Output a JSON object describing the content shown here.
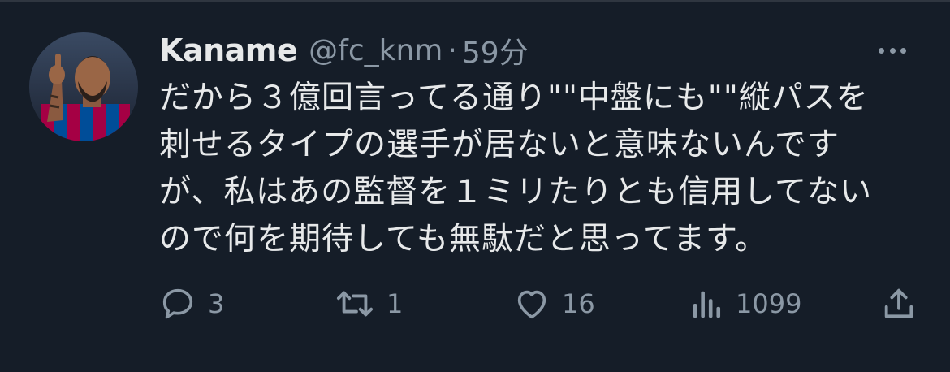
{
  "tweet": {
    "author": {
      "display_name": "Kaname",
      "handle": "@fc_knm",
      "avatar_icon": "user-avatar-photo"
    },
    "separator": "·",
    "time": "59分",
    "text": "だから３億回言ってる通り\"\"中盤にも\"\"縦パスを\n刺せるタイプの選手が居ないと意味ないんです\nが、私はあの監督を１ミリたりとも信用してない\nので何を期待しても無駄だと思ってます。",
    "more_icon": "more-options-icon"
  },
  "actions": {
    "reply": {
      "icon": "reply-icon",
      "count": "3"
    },
    "retweet": {
      "icon": "retweet-icon",
      "count": "1"
    },
    "like": {
      "icon": "heart-icon",
      "count": "16"
    },
    "views": {
      "icon": "views-icon",
      "count": "1099"
    },
    "share": {
      "icon": "share-icon"
    }
  },
  "colors": {
    "background": "#151d28",
    "text": "#e7e9ea",
    "muted": "#8b98a5"
  }
}
